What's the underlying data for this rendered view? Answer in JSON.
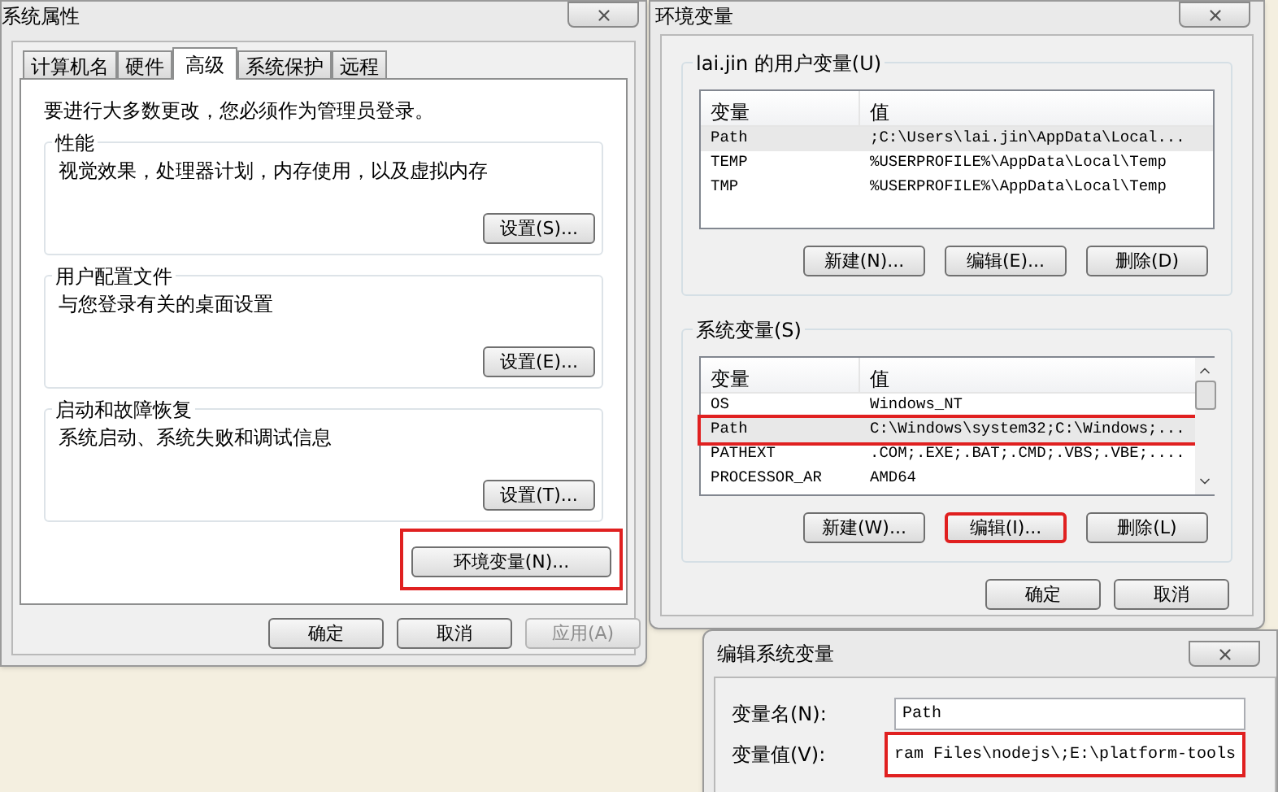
{
  "system_properties": {
    "title": "系统属性",
    "tabs": [
      {
        "label": "计算机名",
        "selected": false
      },
      {
        "label": "硬件",
        "selected": false
      },
      {
        "label": "高级",
        "selected": true
      },
      {
        "label": "系统保护",
        "selected": false
      },
      {
        "label": "远程",
        "selected": false
      }
    ],
    "notice": "要进行大多数更改，您必须作为管理员登录。",
    "groups": [
      {
        "title": "性能",
        "description": "视觉效果，处理器计划，内存使用，以及虚拟内存",
        "button": "设置(S)..."
      },
      {
        "title": "用户配置文件",
        "description": "与您登录有关的桌面设置",
        "button": "设置(E)..."
      },
      {
        "title": "启动和故障恢复",
        "description": "系统启动、系统失败和调试信息",
        "button": "设置(T)..."
      }
    ],
    "env_button": {
      "label": "环境变量(N)...",
      "highlighted": true
    },
    "buttons": [
      {
        "label": "确定",
        "disabled": false
      },
      {
        "label": "取消",
        "disabled": false
      },
      {
        "label": "应用(A)",
        "disabled": true
      }
    ]
  },
  "environment_variables": {
    "title": "环境变量",
    "user_variables": {
      "title": "lai.jin 的用户变量(U)",
      "columns": [
        "变量",
        "值"
      ],
      "rows": [
        {
          "name": "Path",
          "value": ";C:\\Users\\lai.jin\\AppData\\Local...",
          "selected": true,
          "highlighted": false
        },
        {
          "name": "TEMP",
          "value": "%USERPROFILE%\\AppData\\Local\\Temp",
          "selected": false,
          "highlighted": false
        },
        {
          "name": "TMP",
          "value": "%USERPROFILE%\\AppData\\Local\\Temp",
          "selected": false,
          "highlighted": false
        }
      ],
      "buttons": [
        {
          "label": "新建(N)...",
          "highlighted": false
        },
        {
          "label": "编辑(E)...",
          "highlighted": false
        },
        {
          "label": "删除(D)",
          "highlighted": false
        }
      ]
    },
    "system_variables": {
      "title": "系统变量(S)",
      "columns": [
        "变量",
        "值"
      ],
      "rows": [
        {
          "name": "OS",
          "value": "Windows_NT",
          "selected": false,
          "highlighted": false
        },
        {
          "name": "Path",
          "value": "C:\\Windows\\system32;C:\\Windows;...",
          "selected": true,
          "highlighted": true
        },
        {
          "name": "PATHEXT",
          "value": ".COM;.EXE;.BAT;.CMD;.VBS;.VBE;....",
          "selected": false,
          "highlighted": false
        },
        {
          "name": "PROCESSOR_AR",
          "value": "AMD64",
          "selected": false,
          "highlighted": false
        }
      ],
      "buttons": [
        {
          "label": "新建(W)...",
          "highlighted": false
        },
        {
          "label": "编辑(I)...",
          "highlighted": true
        },
        {
          "label": "删除(L)",
          "highlighted": false
        }
      ]
    },
    "buttons": [
      {
        "label": "确定",
        "disabled": false
      },
      {
        "label": "取消",
        "disabled": false
      }
    ]
  },
  "edit_system_variable": {
    "title": "编辑系统变量",
    "fields": [
      {
        "label": "变量名(N):",
        "value": "Path",
        "highlighted": false
      },
      {
        "label": "变量值(V):",
        "value": "ram Files\\nodejs\\;E:\\platform-tools",
        "highlighted": true
      }
    ]
  }
}
